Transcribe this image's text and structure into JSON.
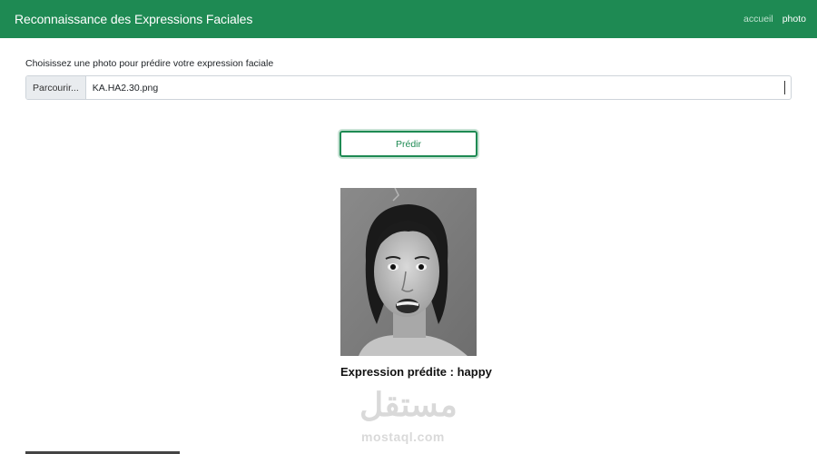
{
  "navbar": {
    "brand": "Reconnaissance des Expressions Faciales",
    "links": [
      {
        "label": "accueil",
        "active": false
      },
      {
        "label": "photo",
        "active": true
      }
    ]
  },
  "form": {
    "label": "Choisissez une photo pour prédire votre expression faciale",
    "browse_label": "Parcourir...",
    "file_name": "KA.HA2.30.png"
  },
  "predict_button": {
    "label": "Prédir"
  },
  "result": {
    "text": "Expression prédite : happy"
  },
  "watermark": {
    "arabic": "مستقل",
    "latin": "mostaql.com"
  },
  "colors": {
    "primary": "#1e8a53",
    "background": "#ffffff"
  }
}
